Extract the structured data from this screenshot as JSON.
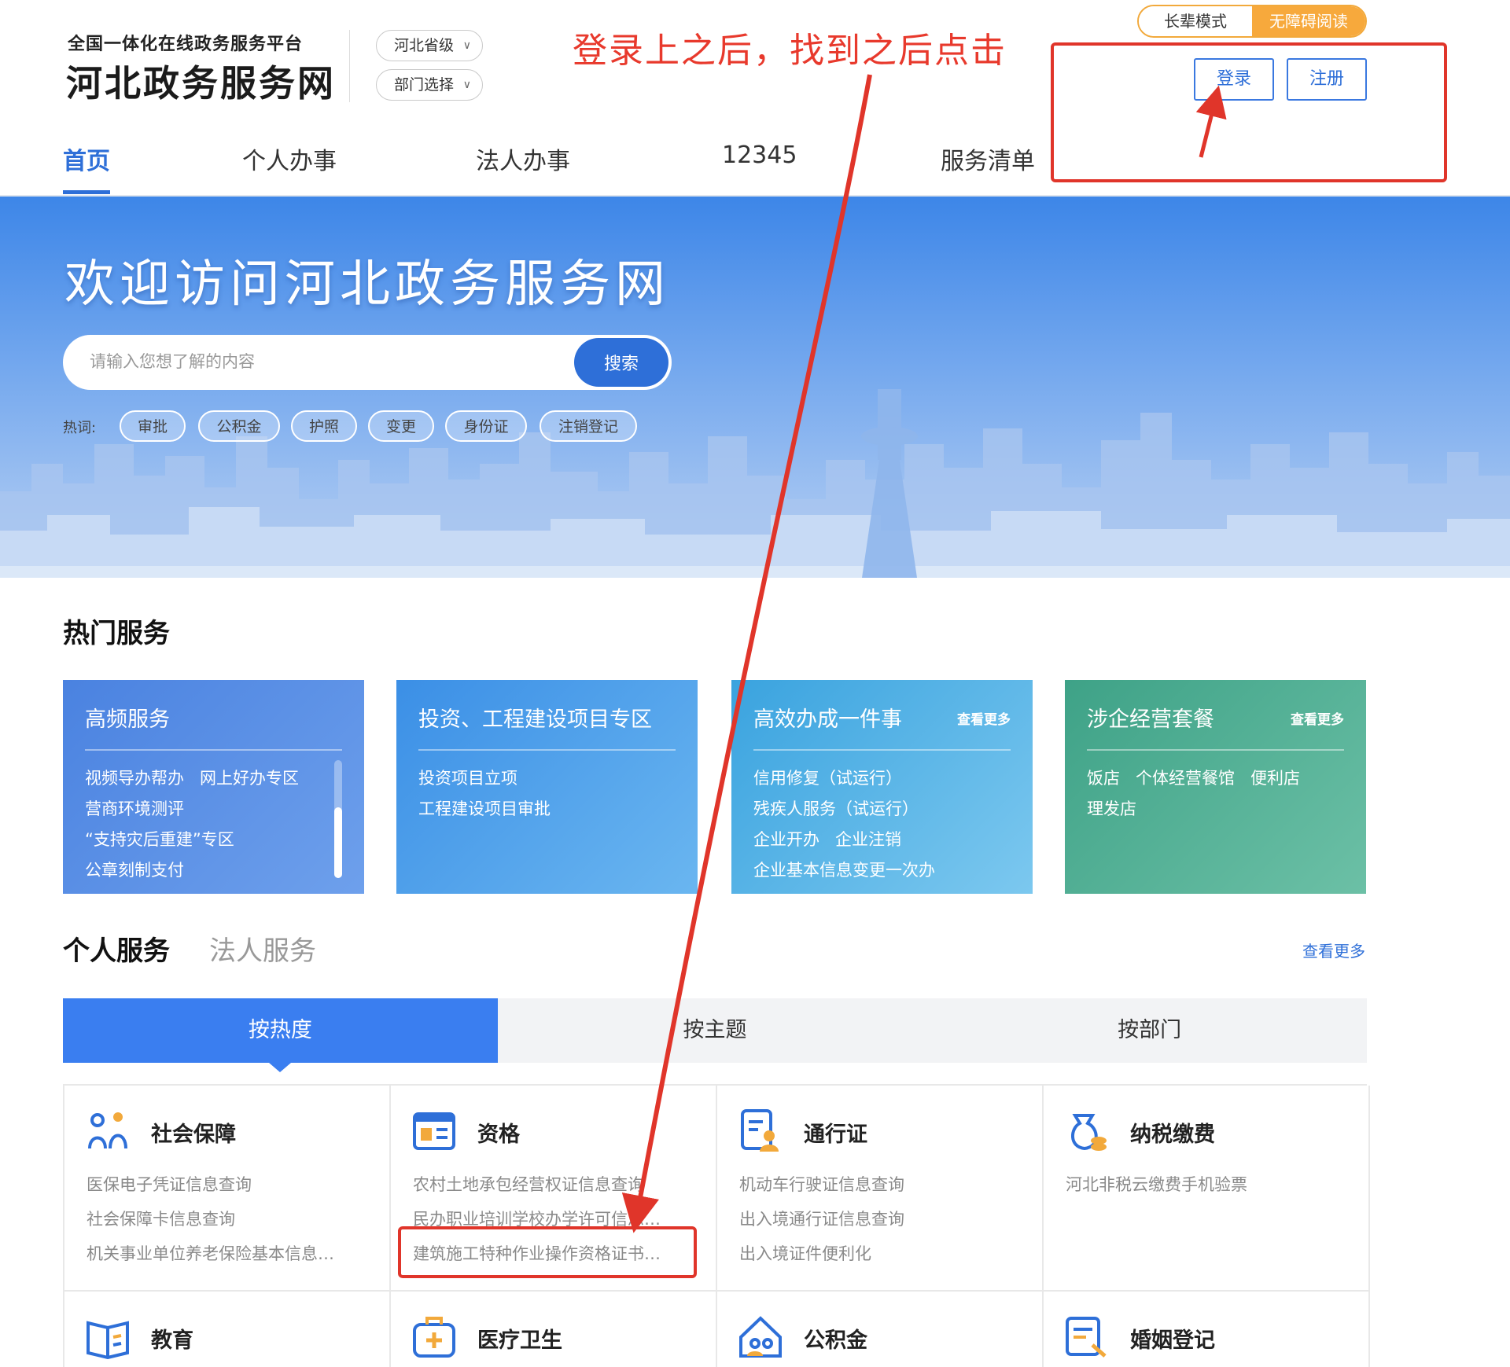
{
  "header": {
    "logo_sub": "全国一体化在线政务服务平台",
    "logo_main": "河北政务服务网",
    "region_select": "河北省级",
    "dept_select": "部门选择",
    "mode_elder": "长辈模式",
    "mode_accessible": "无障碍阅读",
    "login_label": "登录",
    "register_label": "注册",
    "annotation": "登录上之后，找到之后点击"
  },
  "nav": {
    "items": [
      {
        "label": "首页"
      },
      {
        "label": "个人办事"
      },
      {
        "label": "法人办事"
      },
      {
        "label": "12345"
      },
      {
        "label": "服务清单"
      }
    ]
  },
  "banner": {
    "title": "欢迎访问河北政务服务网",
    "search_placeholder": "请输入您想了解的内容",
    "search_button": "搜索",
    "hot_label": "热词:",
    "hot_tags": [
      "审批",
      "公积金",
      "护照",
      "变更",
      "身份证",
      "注销登记"
    ]
  },
  "hot_services": {
    "title": "热门服务",
    "cards": [
      {
        "title": "高频服务",
        "more": "",
        "color": "#4a82e0",
        "lines": [
          [
            "视频导办帮办",
            "网上好办专区"
          ],
          [
            "营商环境测评"
          ],
          [
            "“支持灾后重建”专区"
          ],
          [
            "公章刻制支付"
          ]
        ]
      },
      {
        "title": "投资、工程建设项目专区",
        "more": "",
        "color": "#3b8fe6",
        "lines": [
          [
            "投资项目立项"
          ],
          [
            "工程建设项目审批"
          ]
        ]
      },
      {
        "title": "高效办成一件事",
        "more": "查看更多",
        "color": "#3aa3df",
        "lines": [
          [
            "信用修复（试运行）"
          ],
          [
            "残疾人服务（试运行）"
          ],
          [
            "企业开办",
            "企业注销"
          ],
          [
            "企业基本信息变更一次办"
          ]
        ]
      },
      {
        "title": "涉企经营套餐",
        "more": "查看更多",
        "color": "#3ea287",
        "lines": [
          [
            "饭店",
            "个体经营餐馆",
            "便利店"
          ],
          [
            "理发店"
          ]
        ]
      }
    ]
  },
  "services": {
    "tab_personal": "个人服务",
    "tab_legal": "法人服务",
    "view_more": "查看更多",
    "segments": [
      "按热度",
      "按主题",
      "按部门"
    ],
    "categories": [
      {
        "title": "社会保障",
        "icon": "social-security-icon",
        "links": [
          "医保电子凭证信息查询",
          "社会保障卡信息查询",
          "机关事业单位养老保险基本信息…"
        ]
      },
      {
        "title": "资格",
        "icon": "qualification-icon",
        "links": [
          "农村土地承包经营权证信息查询",
          "民办职业培训学校办学许可信息…",
          "建筑施工特种作业操作资格证书…"
        ]
      },
      {
        "title": "通行证",
        "icon": "pass-icon",
        "links": [
          "机动车行驶证信息查询",
          "出入境通行证信息查询",
          "出入境证件便利化"
        ]
      },
      {
        "title": "纳税缴费",
        "icon": "tax-icon",
        "links": [
          "河北非税云缴费手机验票"
        ]
      },
      {
        "title": "教育",
        "icon": "education-icon",
        "links": []
      },
      {
        "title": "医疗卫生",
        "icon": "medical-icon",
        "links": []
      },
      {
        "title": "公积金",
        "icon": "housing-fund-icon",
        "links": []
      },
      {
        "title": "婚姻登记",
        "icon": "marriage-icon",
        "links": []
      }
    ]
  },
  "colors": {
    "brand": "#2e6fd8",
    "annotation": "#e0352a",
    "accessible": "#f7a93c"
  }
}
